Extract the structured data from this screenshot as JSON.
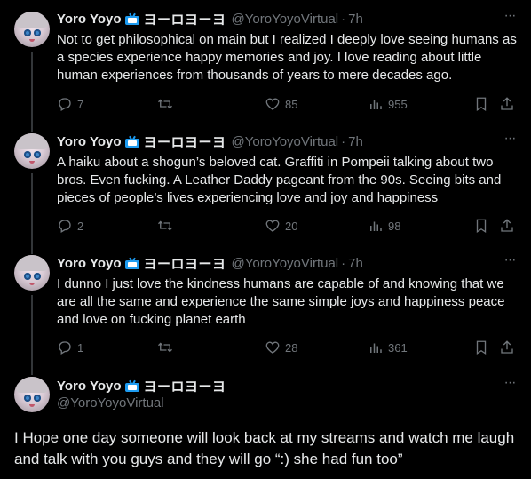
{
  "author": {
    "name": "Yoro Yoyo",
    "kana": "ヨーロヨーヨ",
    "handle": "@YoroYoyoVirtual",
    "badge_icon": "tv-icon"
  },
  "thread": [
    {
      "time": "7h",
      "text": "Not to get philosophical on main but I realized I deeply love seeing humans as a species experience happy memories and joy. I love reading about little human experiences from thousands of years to mere decades ago.",
      "replies": "7",
      "retweets": "",
      "likes": "85",
      "views": "955"
    },
    {
      "time": "7h",
      "text": "A haiku about a shogun’s beloved cat. Graffiti in Pompeii talking about two bros. Even fucking. A Leather Daddy pageant from the 90s. Seeing bits and pieces of people’s lives experiencing love and joy and happiness",
      "replies": "2",
      "retweets": "",
      "likes": "20",
      "views": "98"
    },
    {
      "time": "7h",
      "text": "I dunno I just love the kindness humans are capable of and knowing that we are all the same and experience the same simple joys and happiness peace and love on fucking planet earth",
      "replies": "1",
      "retweets": "",
      "likes": "28",
      "views": "361"
    }
  ],
  "main_tweet": {
    "text": "I Hope one day someone will look back at my streams and watch me laugh and talk with you guys and they will go “:) she had fun too”"
  },
  "ui": {
    "dot_separator": "·",
    "more_label": "···"
  },
  "colors": {
    "background": "#000000",
    "text": "#e7e9ea",
    "muted": "#71767b",
    "thread_line": "#333639",
    "badge": "#1d9bf0"
  }
}
